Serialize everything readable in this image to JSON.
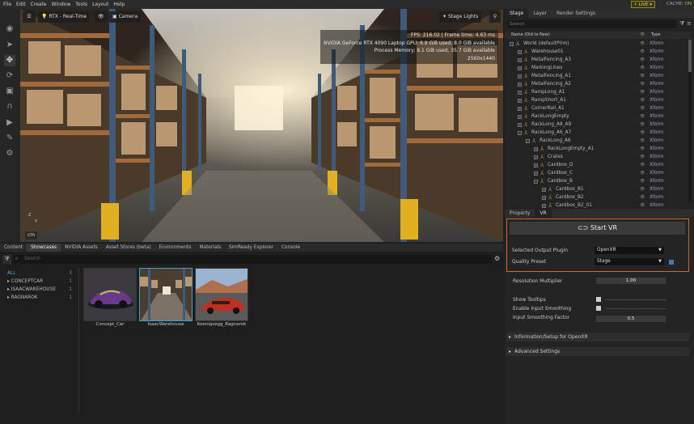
{
  "menubar": {
    "items": [
      "File",
      "Edit",
      "Create",
      "Window",
      "Tools",
      "Layout",
      "Help"
    ],
    "live_label": "LIVE",
    "cache_label": "CACHE:",
    "cache_status": "ON"
  },
  "viewport": {
    "renderer": "RTX - Real-Time",
    "camera": "Camera",
    "stage_lights": "Stage Lights",
    "stats": [
      "FPS: 216.02  |  Frame time: 4.63 ms",
      "NVIDIA GeForce RTX 4090 Laptop GPU: 6.9 GiB used, 8.0 GiB available",
      "Process Memory: 8.1 GiB used, 35.7 GiB available",
      "2560x1440"
    ],
    "unit": "cm",
    "axis_z": "Z",
    "axis_y": "Y"
  },
  "stage": {
    "tabs": [
      "Stage",
      "Layer",
      "Render Settings"
    ],
    "search_placeholder": "Search",
    "col_name": "Name (Old to New)",
    "col_type": "Type",
    "rows": [
      {
        "label": "World (defaultPrim)",
        "type": "Xform",
        "indent": 0,
        "exp": "−"
      },
      {
        "label": "Warehouse01",
        "type": "Xform",
        "indent": 1,
        "exp": "+"
      },
      {
        "label": "MetalFencing_A3",
        "type": "Xform",
        "indent": 1,
        "exp": "+"
      },
      {
        "label": "MarkingLines",
        "type": "Xform",
        "indent": 1,
        "exp": "+"
      },
      {
        "label": "MetalFencing_A1",
        "type": "Xform",
        "indent": 1,
        "exp": "+"
      },
      {
        "label": "MetalFencing_A2",
        "type": "Xform",
        "indent": 1,
        "exp": "+"
      },
      {
        "label": "RampLong_A1",
        "type": "Xform",
        "indent": 1,
        "exp": "+"
      },
      {
        "label": "RampShort_A1",
        "type": "Xform",
        "indent": 1,
        "exp": "+"
      },
      {
        "label": "CornerRail_A1",
        "type": "Xform",
        "indent": 1,
        "exp": "+"
      },
      {
        "label": "RackLongEmpty",
        "type": "Xform",
        "indent": 1,
        "exp": "+"
      },
      {
        "label": "RackLong_A8_A9",
        "type": "Xform",
        "indent": 1,
        "exp": "+"
      },
      {
        "label": "RackLong_A6_A7",
        "type": "Xform",
        "indent": 1,
        "exp": "−"
      },
      {
        "label": "RackLong_A6",
        "type": "Xform",
        "indent": 2,
        "exp": "−"
      },
      {
        "label": "RackLongEmpty_A1",
        "type": "Xform",
        "indent": 3,
        "exp": "+"
      },
      {
        "label": "Crates",
        "type": "Xform",
        "indent": 3,
        "exp": "+"
      },
      {
        "label": "Cardbox_D",
        "type": "Xform",
        "indent": 3,
        "exp": "+"
      },
      {
        "label": "Cardbox_C",
        "type": "Xform",
        "indent": 3,
        "exp": "+"
      },
      {
        "label": "Cardbox_B",
        "type": "Xform",
        "indent": 3,
        "exp": "−"
      },
      {
        "label": "Cardbox_B1",
        "type": "Xform",
        "indent": 4,
        "exp": "+"
      },
      {
        "label": "Cardbox_B2",
        "type": "Xform",
        "indent": 4,
        "exp": "+"
      },
      {
        "label": "Cardbox_B2_01",
        "type": "Xform",
        "indent": 4,
        "exp": "+"
      }
    ]
  },
  "property": {
    "tabs": [
      "Property",
      "VR"
    ],
    "start_vr": "Start VR",
    "output_plugin_label": "Selected Output Plugin",
    "output_plugin_value": "OpenXR",
    "quality_preset_label": "Quality Preset",
    "quality_preset_value": "Stage",
    "resolution_label": "Resolution Multiplier",
    "resolution_value": "1.00",
    "tooltips_label": "Show Tooltips",
    "smoothing_label": "Enable Input Smoothing",
    "smoothing_factor_label": "Input Smoothing Factor",
    "smoothing_factor_value": "0.5",
    "section_info": "Information/Setup for OpenXR",
    "section_advanced": "Advanced Settings"
  },
  "browser": {
    "tabs": [
      "Content",
      "Showcases",
      "NVIDIA Assets",
      "Asset Stores (beta)",
      "Environments",
      "Materials",
      "SimReady Explorer",
      "Console"
    ],
    "active_tab": 1,
    "search_placeholder": "Search",
    "tree": [
      {
        "label": "ALL",
        "count": "3"
      },
      {
        "label": "CONCEPTCAR",
        "count": "1"
      },
      {
        "label": "ISAACWAREHOUSE",
        "count": "1"
      },
      {
        "label": "RAGNAROK",
        "count": "1"
      }
    ],
    "items": [
      {
        "caption": "Concept_Car"
      },
      {
        "caption": "IsaacWarehouse"
      },
      {
        "caption": "Koenigsegg_Ragnarok"
      }
    ]
  },
  "colors": {
    "accent_orange": "#d06a2c",
    "selection_blue": "#3fa0c8",
    "type_text": "#9aa0cf",
    "live_yellow": "#e8d24a",
    "cache_green": "#7ccf4a"
  },
  "icons": [
    "menu-icon",
    "bulb-icon",
    "eye-icon",
    "camera-icon",
    "light-icon",
    "pin-icon",
    "headset-icon",
    "filter-icon",
    "settings-icon",
    "xform-icon"
  ]
}
